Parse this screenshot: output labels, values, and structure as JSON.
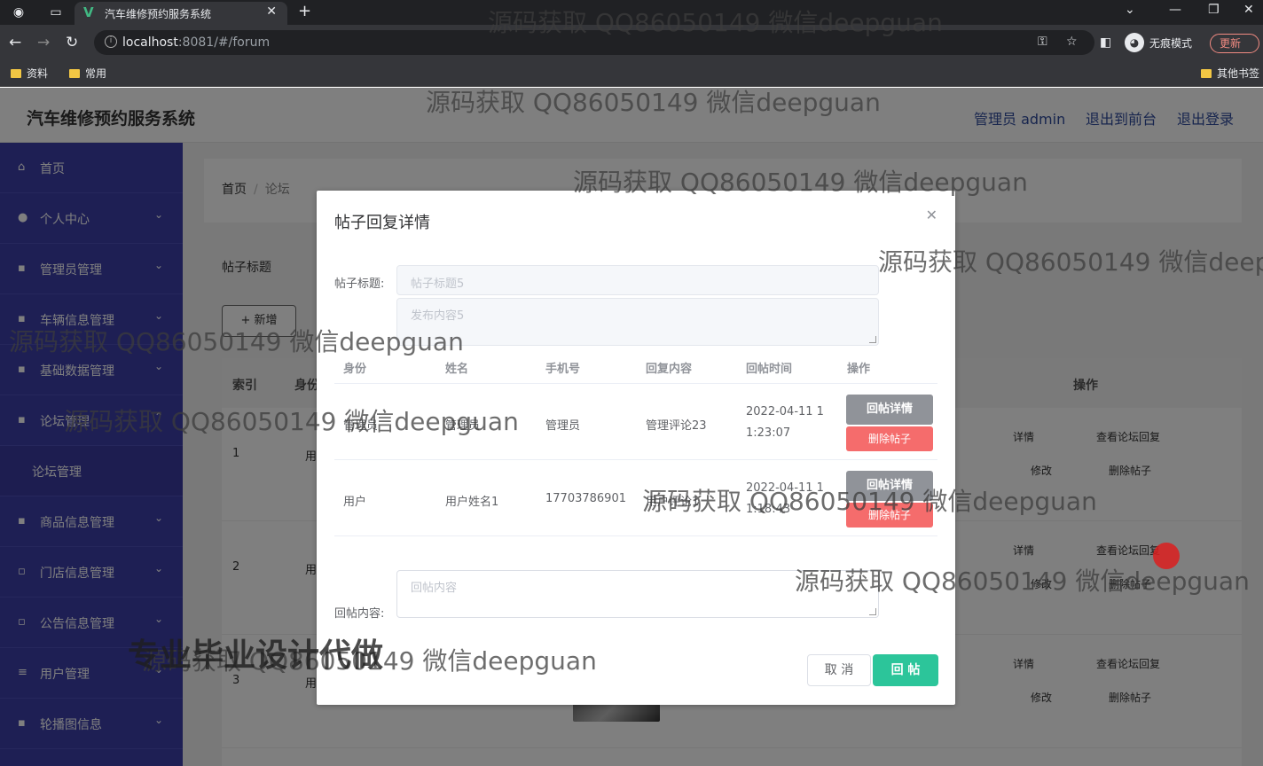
{
  "browser": {
    "tab_title": "汽车维修预约服务系统",
    "url_host": "localhost",
    "url_rest": ":8081/#/forum",
    "incognito_label": "无痕模式",
    "update_label": "更新",
    "bookmarks": [
      "资料",
      "常用"
    ],
    "other_bookmarks": "其他书签"
  },
  "app": {
    "title": "汽车维修预约服务系统",
    "header_links": [
      "管理员 admin",
      "退出到前台",
      "退出登录"
    ]
  },
  "sidebar": {
    "items": [
      "首页",
      "个人中心",
      "管理员管理",
      "车辆信息管理",
      "基础数据管理",
      "论坛管理",
      "论坛管理",
      "商品信息管理",
      "门店信息管理",
      "公告信息管理",
      "用户管理",
      "轮播图信息"
    ]
  },
  "content": {
    "breadcrumb": [
      "首页",
      "论坛"
    ],
    "search_label": "帖子标题",
    "add_button": "+ 新增",
    "table_headers": [
      "索引",
      "身份",
      "操作"
    ],
    "rows": [
      {
        "index": "1",
        "identity": "用"
      },
      {
        "index": "2",
        "identity": "用"
      },
      {
        "index": "3",
        "identity": "用"
      }
    ],
    "row_actions": {
      "detail": "详情",
      "view_replies": "查看论坛回复",
      "edit": "修改",
      "delete": "删除帖子"
    }
  },
  "dialog": {
    "title": "帖子回复详情",
    "post_title_label": "帖子标题:",
    "post_title_value": "帖子标题5",
    "post_content_value": "发布内容5",
    "reply_headers": [
      "身份",
      "姓名",
      "手机号",
      "回复内容",
      "回帖时间",
      "操作"
    ],
    "replies": [
      {
        "identity": "管理员",
        "name": "管理员",
        "phone": "管理员",
        "content": "管理评论23",
        "time_line1": "2022-04-11 1",
        "time_line2": "1:23:07"
      },
      {
        "identity": "用户",
        "name": "用户姓名1",
        "phone": "17703786901",
        "content": "用户评论1",
        "time_line1": "2022-04-11 1",
        "time_line2": "1:18:43"
      }
    ],
    "reply_detail_btn": "回帖详情",
    "reply_delete_btn": "删除帖子",
    "reply_content_label": "回帖内容:",
    "reply_placeholder": "回帖内容",
    "cancel": "取 消",
    "submit": "回 帖"
  },
  "watermarks": {
    "text": "源码获取 QQ86050149 微信deepguan",
    "big": "专业毕业设计代做"
  }
}
